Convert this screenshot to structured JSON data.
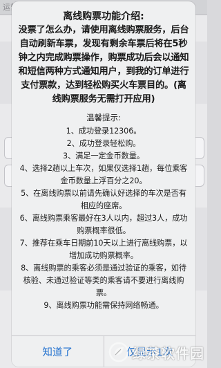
{
  "background": {
    "topbar_text": "运营"
  },
  "dialog": {
    "title": "离线购票功能介绍:",
    "intro": "没票了怎么办，请使用离线购票服务，后台自动刷新车票，发现有剩余车票后将在5秒钟之内完成购票操作，购票成功后会以通知和短信两种方式通知用户，到我的订单进行支付票款，达到轻松购买火车票目的。(离线购票服务无需打开应用)",
    "tips_heading": "温馨提示:",
    "tips": [
      "1、成功登录12306。",
      "2、成功登录轻松购。",
      "3、满足一定金币数量。",
      "4、选择2趟以上车次，如果仅选择1趟，每位乘客金币数量上浮百分之20。",
      "5、在离线购票以前请先确认好选择的车次是否有相应的座席。",
      "6、离线购票乘客最好在3人以内，超过3人，成功购票概率很低。",
      "7、推荐在乘车日期前10天以上进行离线购票，以增加成功购票概率。",
      "8、离线购票的乘客必须是通过验证的乘客，如待核验、未通过验证等类的乘客请不要进行离线购票。",
      "9、离线购票功能需保持网络畅通。"
    ],
    "buttons": {
      "ok": "知道了",
      "no_more": "仅显示1次"
    }
  },
  "watermark": {
    "text": "绿茶软件园"
  },
  "colors": {
    "accent": "#1f6fcf",
    "dialog_bg": "#eff0f1",
    "text": "#1a1a1a"
  }
}
